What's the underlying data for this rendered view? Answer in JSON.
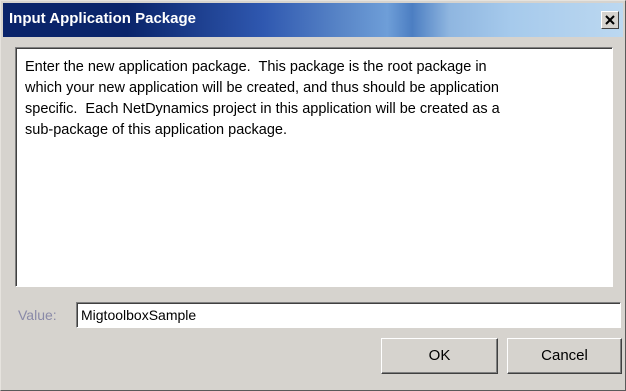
{
  "dialog": {
    "title": "Input Application Package",
    "close_icon": "close-icon",
    "message": "Enter the new application package.  This package is the root package in\nwhich your new application will be created, and thus should be application\nspecific.  Each NetDynamics project in this application will be created as a\nsub-package of this application package.",
    "value_label": "Value:",
    "value_input": "MigtoolboxSample",
    "ok_label": "OK",
    "cancel_label": "Cancel"
  },
  "colors": {
    "title_bar_start": "#0a246a",
    "title_bar_end": "#bcd8f0",
    "dialog_background": "#d6d3ce",
    "value_label_color": "#8a8aa8"
  }
}
